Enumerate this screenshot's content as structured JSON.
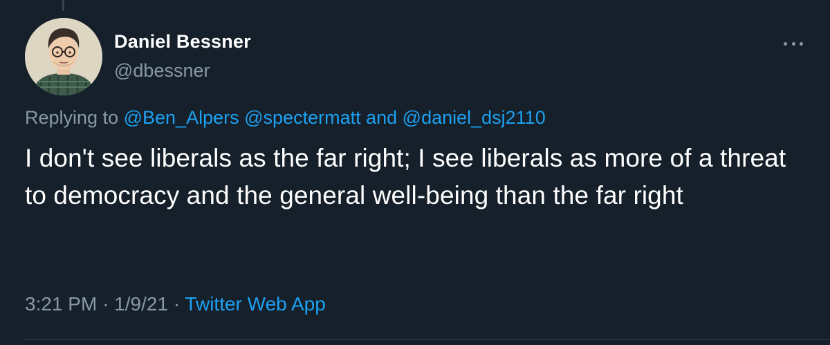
{
  "author": {
    "display_name": "Daniel Bessner",
    "handle": "@dbessner"
  },
  "reply": {
    "prefix": "Replying to",
    "mentions": [
      "@Ben_Alpers",
      "@spectermatt",
      "@daniel_dsj2110"
    ],
    "joiner_1": " ",
    "joiner_2": " and "
  },
  "tweet": {
    "text": "I don't see liberals as the far right; I see liberals as more of a threat to democracy and the general well-being than the far right"
  },
  "meta": {
    "time": "3:21 PM",
    "date": "1/9/21",
    "separator": "·",
    "source": "Twitter Web App"
  },
  "colors": {
    "background": "#15202b",
    "primary_text": "#ffffff",
    "secondary_text": "#8899a6",
    "link": "#1da1f2"
  },
  "icons": {
    "more": "more-horizontal-icon"
  }
}
